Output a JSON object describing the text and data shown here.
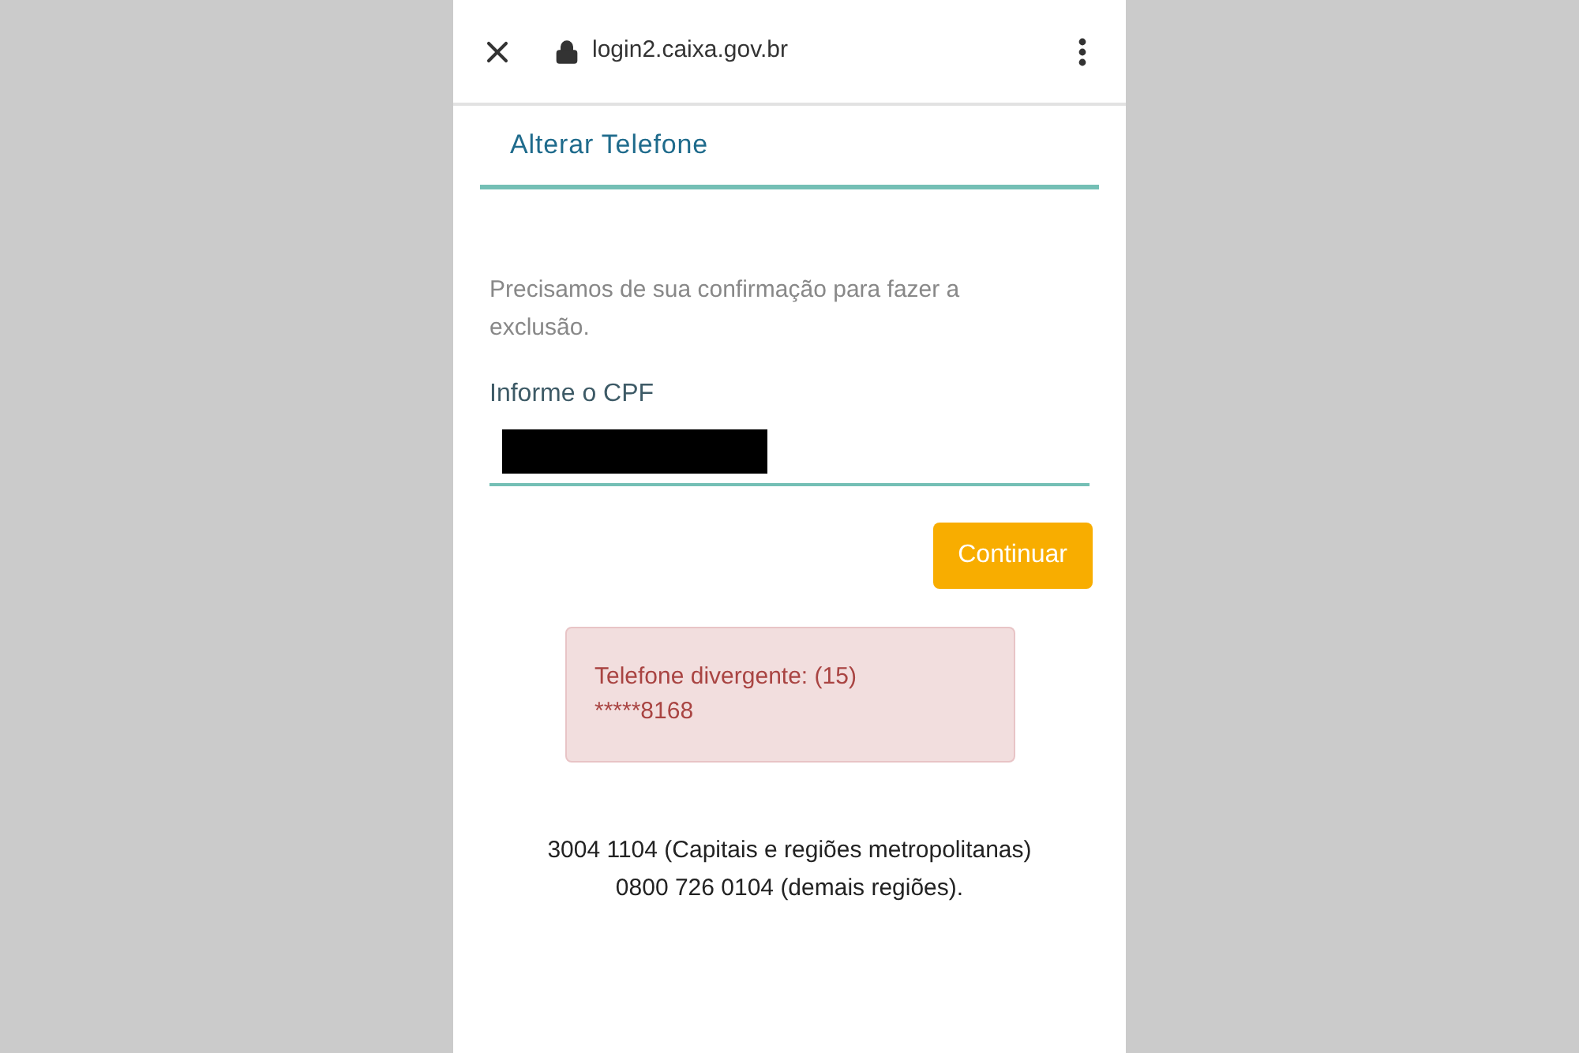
{
  "browser_bar": {
    "url": "login2.caixa.gov.br"
  },
  "page_title": "Alterar Telefone",
  "message": "Precisamos de sua confirmação para fazer a exclusão.",
  "cpf_field": {
    "label": "Informe o CPF",
    "redacted": true
  },
  "button": "Continuar",
  "error": {
    "lines": [
      "Telefone divergente: (15)",
      "*****8168"
    ]
  },
  "footer": [
    "3004 1104 (Capitais e regiões metropolitanas)",
    "0800 726 0104 (demais regiões)."
  ]
}
